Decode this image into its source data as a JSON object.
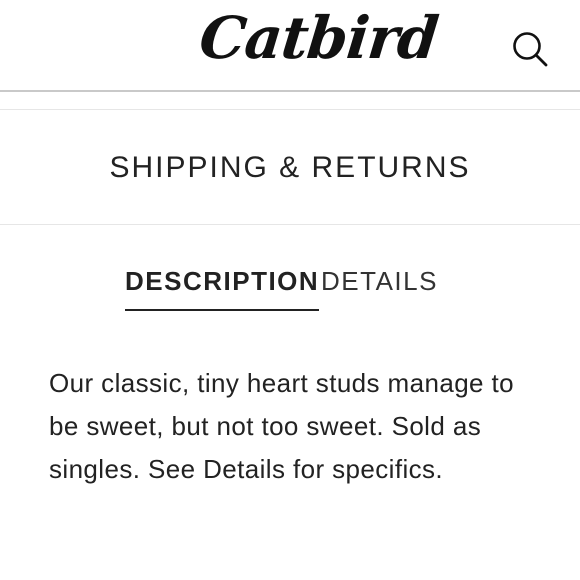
{
  "header": {
    "logo_text": "Catbird",
    "search_icon": "search-icon"
  },
  "accordion": {
    "shipping_label": "SHIPPING & RETURNS"
  },
  "tabs": [
    {
      "label": "DESCRIPTION",
      "active": true
    },
    {
      "label": "DETAILS",
      "active": false
    }
  ],
  "description": {
    "text": "Our classic, tiny heart studs manage to be sweet, but not too sweet. Sold as singles. See Details for specifics."
  },
  "colors": {
    "text": "#222222",
    "divider": "#c9c9c9",
    "background": "#ffffff"
  }
}
